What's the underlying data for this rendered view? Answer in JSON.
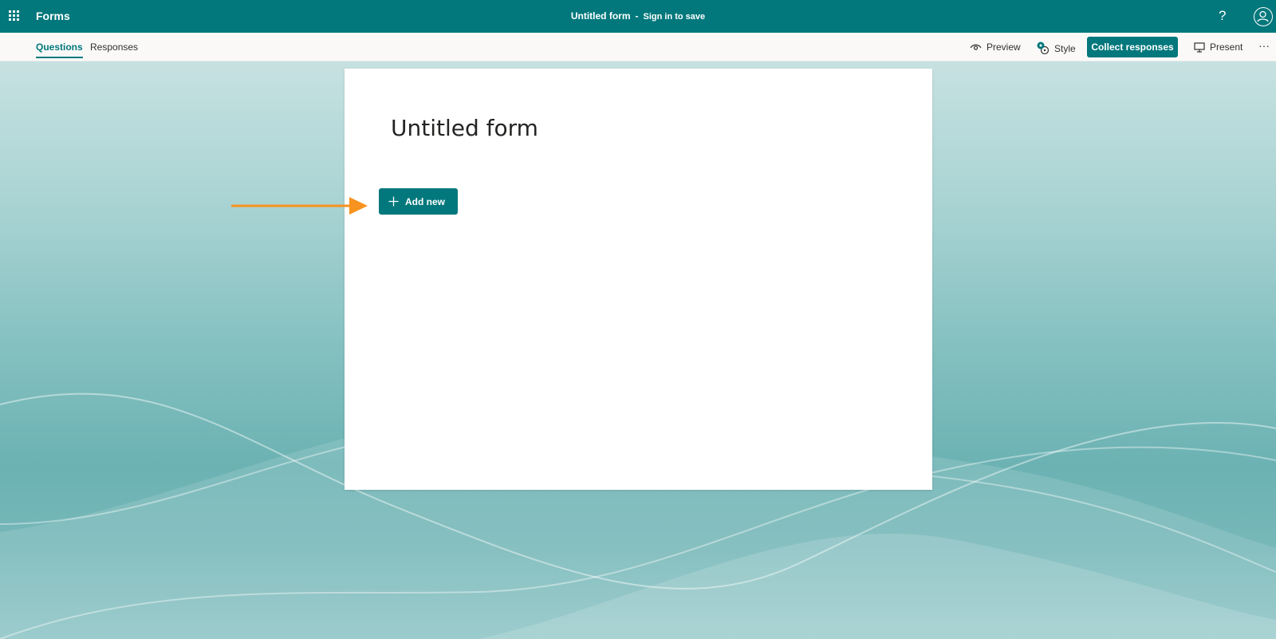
{
  "topbar": {
    "app_name": "Forms",
    "form_title": "Untitled form",
    "separator": "-",
    "signin_label": "Sign in to save",
    "help_glyph": "?"
  },
  "tabs": [
    {
      "label": "Questions",
      "active": true
    },
    {
      "label": "Responses",
      "active": false
    }
  ],
  "toolbar": {
    "preview_label": "Preview",
    "style_label": "Style",
    "collect_label": "Collect responses",
    "present_label": "Present",
    "more_glyph": "···"
  },
  "form": {
    "title": "Untitled form",
    "add_new_label": "Add new"
  },
  "icons": {
    "app_launcher": "waffle-icon",
    "help": "help-icon",
    "account": "account-icon",
    "preview": "eye-icon",
    "style": "palette-icon",
    "present": "monitor-icon",
    "more": "more-icon",
    "add": "plus-icon",
    "annotation": "arrow-icon"
  },
  "colors": {
    "brand": "#03787c",
    "annotation_arrow": "#f7931e",
    "style_badge": "#03787c"
  }
}
